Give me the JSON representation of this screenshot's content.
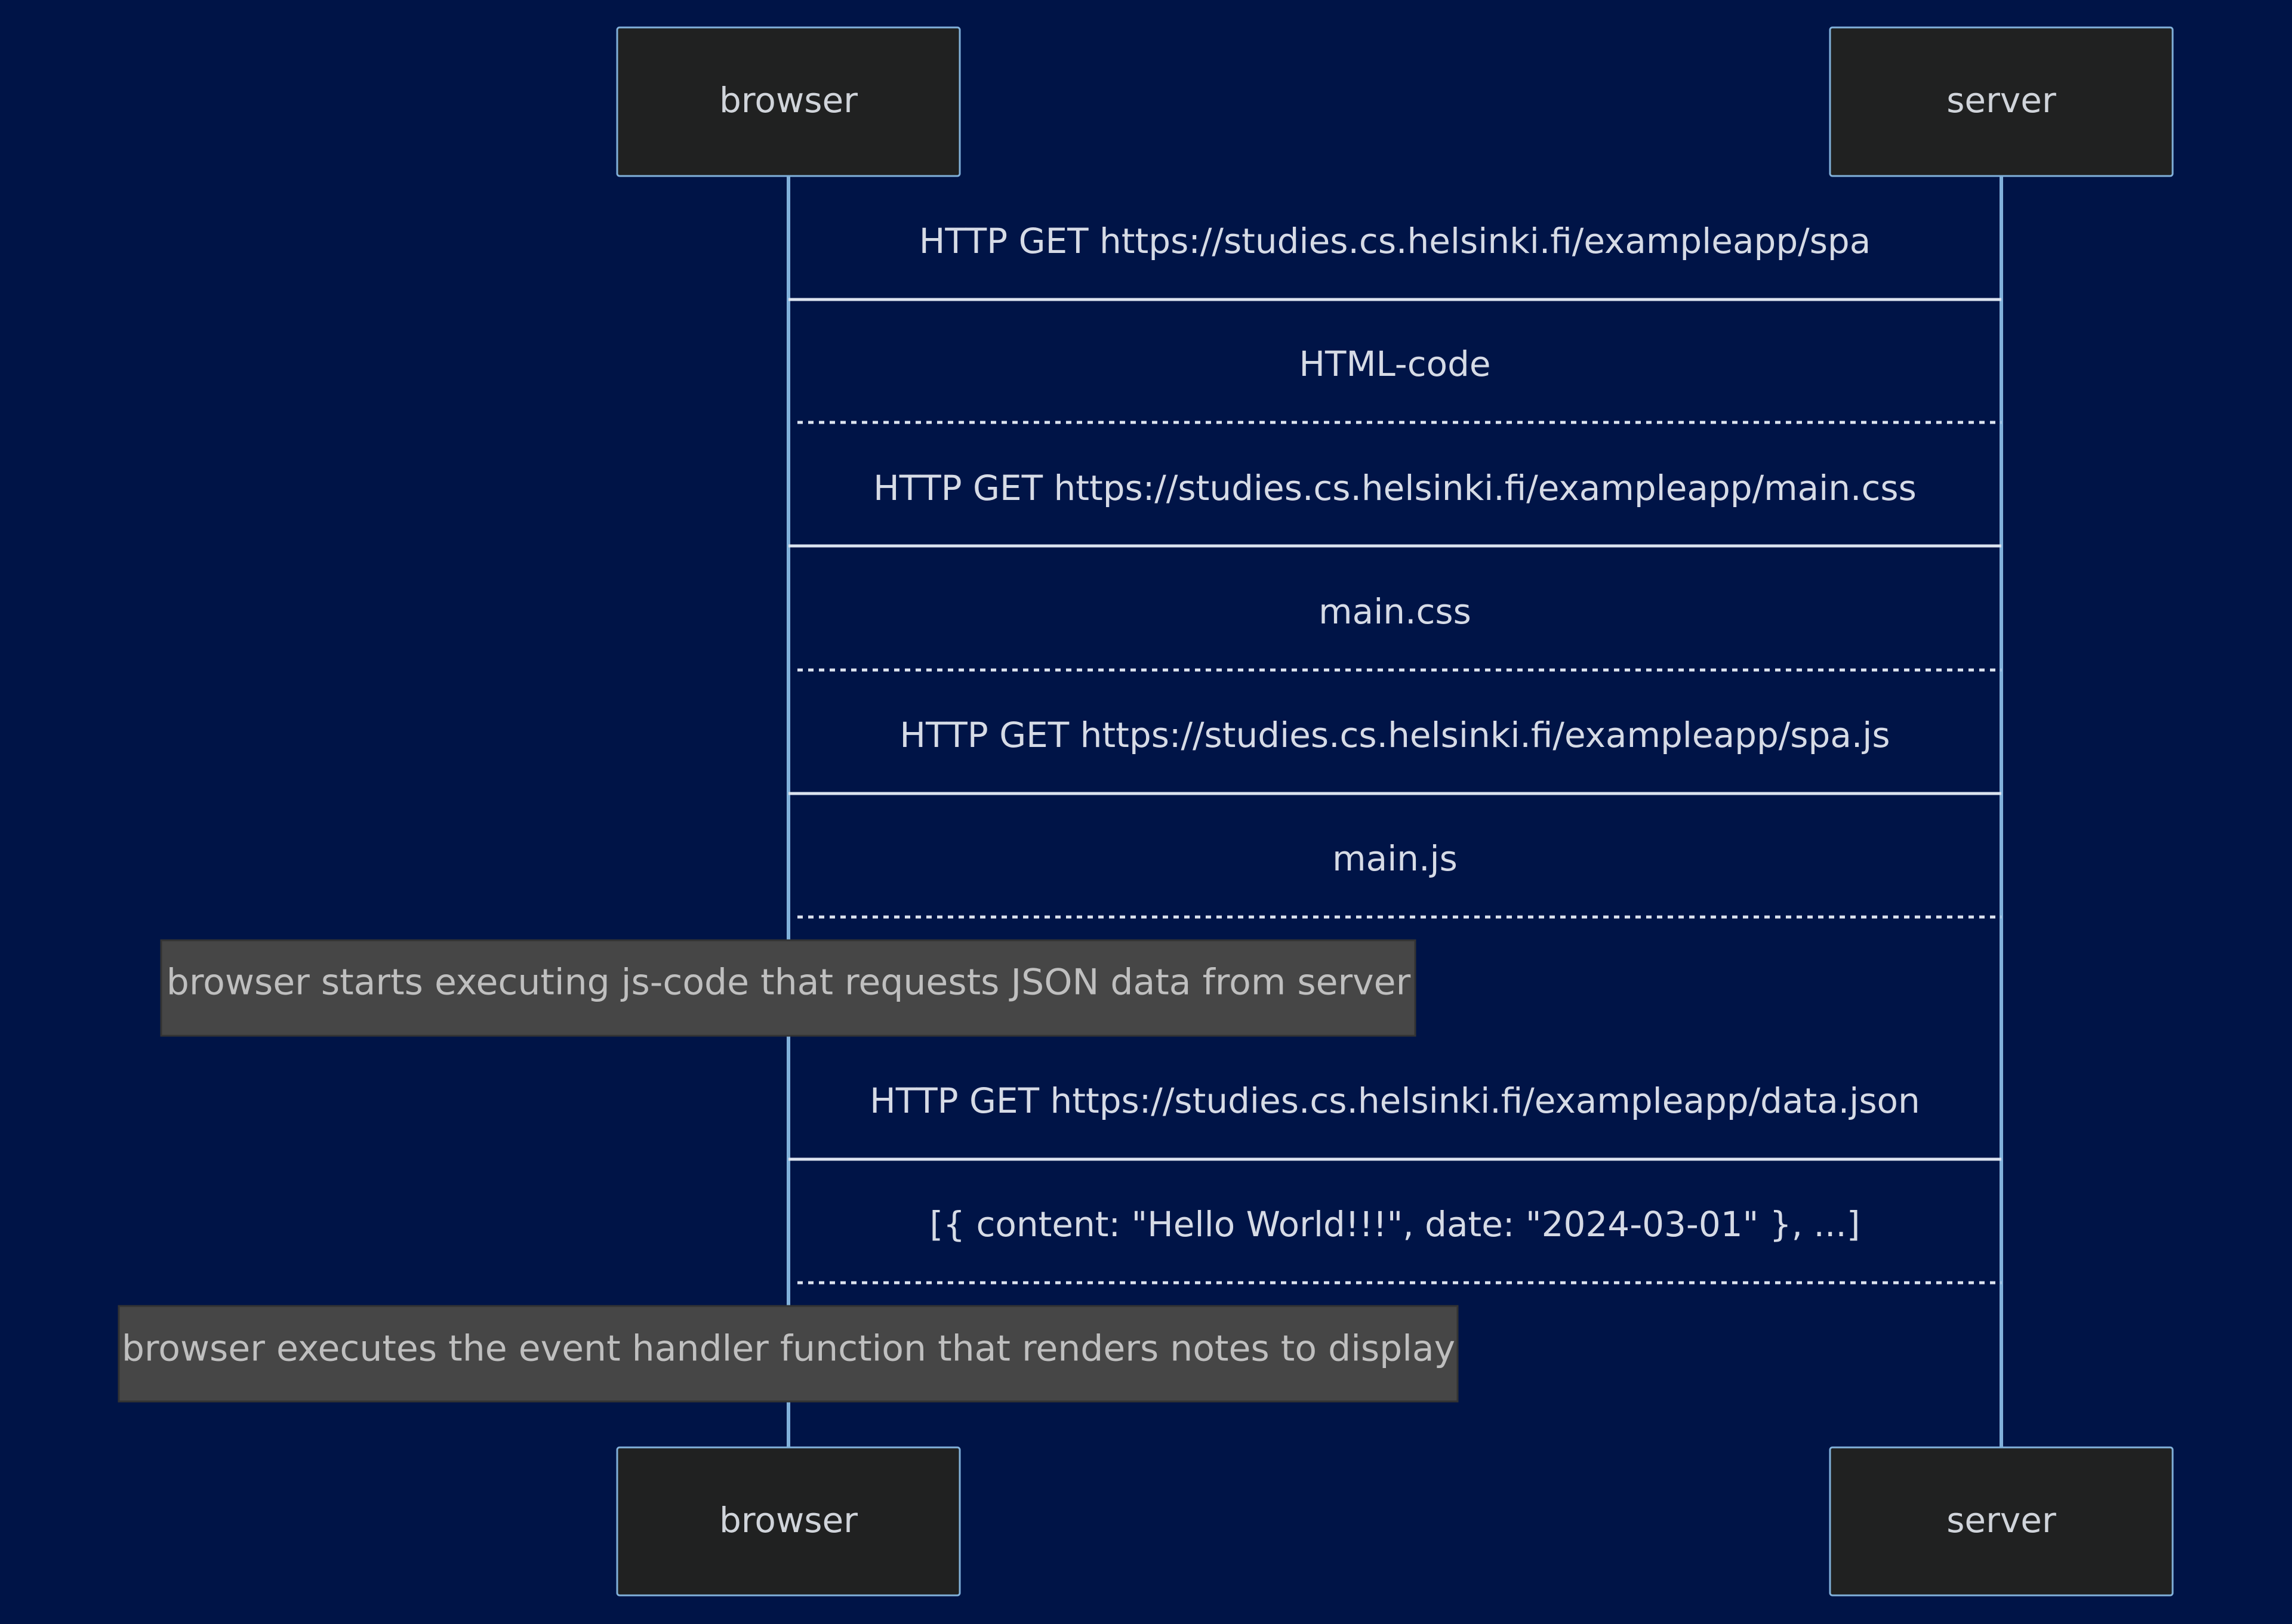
{
  "diagram": {
    "type": "sequence",
    "participants": [
      {
        "id": "browser",
        "label": "browser"
      },
      {
        "id": "server",
        "label": "server"
      }
    ],
    "steps": [
      {
        "kind": "message",
        "from": "browser",
        "to": "server",
        "style": "solid",
        "text": "HTTP GET https://studies.cs.helsinki.fi/exampleapp/spa"
      },
      {
        "kind": "message",
        "from": "server",
        "to": "browser",
        "style": "dashed",
        "text": "HTML-code"
      },
      {
        "kind": "message",
        "from": "browser",
        "to": "server",
        "style": "solid",
        "text": "HTTP GET https://studies.cs.helsinki.fi/exampleapp/main.css"
      },
      {
        "kind": "message",
        "from": "server",
        "to": "browser",
        "style": "dashed",
        "text": "main.css"
      },
      {
        "kind": "message",
        "from": "browser",
        "to": "server",
        "style": "solid",
        "text": "HTTP GET https://studies.cs.helsinki.fi/exampleapp/spa.js"
      },
      {
        "kind": "message",
        "from": "server",
        "to": "browser",
        "style": "dashed",
        "text": "main.js"
      },
      {
        "kind": "note",
        "over": "browser",
        "text": "browser starts executing js-code that requests JSON data from server"
      },
      {
        "kind": "message",
        "from": "browser",
        "to": "server",
        "style": "solid",
        "text": "HTTP GET https://studies.cs.helsinki.fi/exampleapp/data.json"
      },
      {
        "kind": "message",
        "from": "server",
        "to": "browser",
        "style": "dashed",
        "text": "[{ content: \"Hello World!!!\", date: \"2024-03-01\" }, ...]"
      },
      {
        "kind": "note",
        "over": "browser",
        "text": "browser executes the event handler function that renders notes to display"
      }
    ]
  },
  "colors": {
    "background": "#001447",
    "actor_fill": "#202121",
    "actor_border": "#81b1db",
    "lifeline": "#81b1db",
    "message_line": "#dce3ef",
    "note_fill": "#464646"
  }
}
